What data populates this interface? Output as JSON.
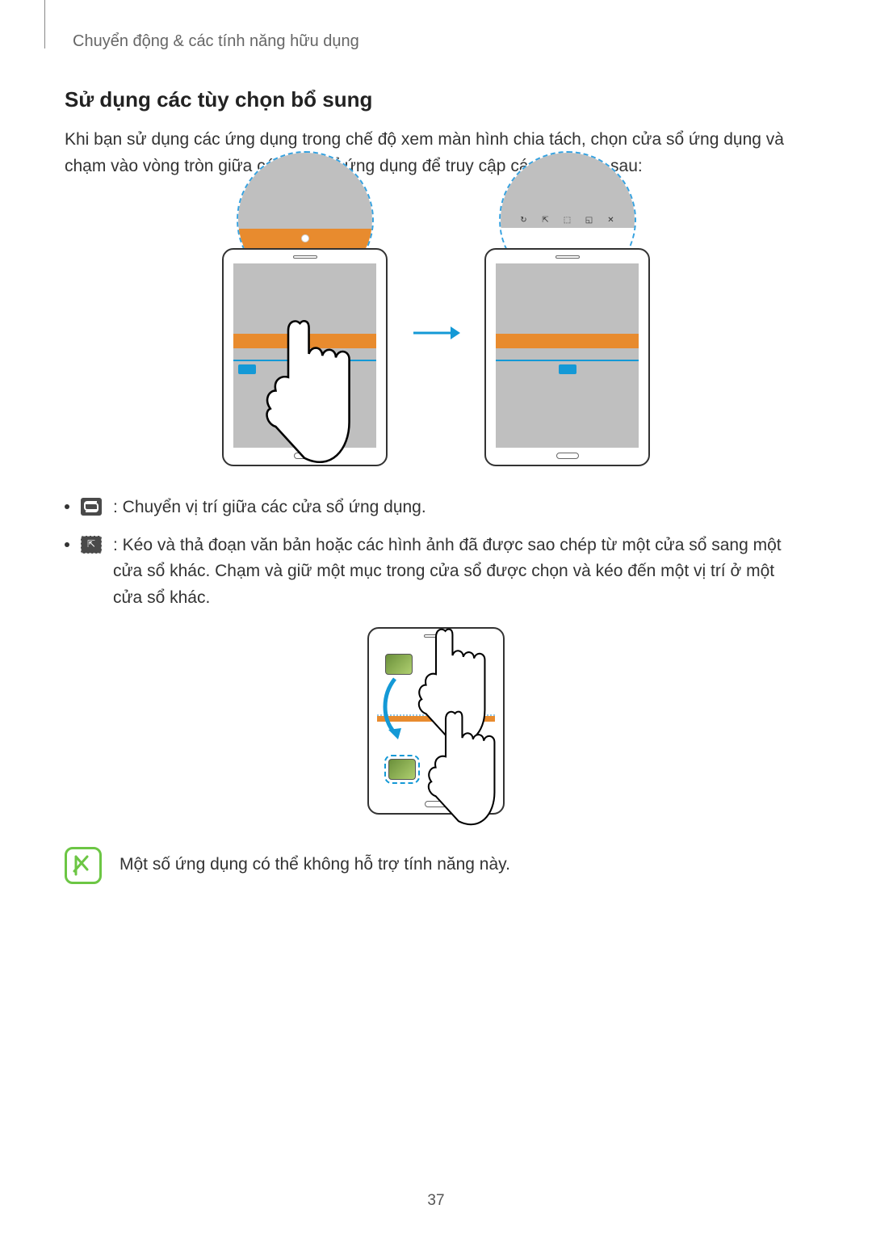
{
  "breadcrumb": "Chuyển động & các tính năng hữu dụng",
  "heading": "Sử dụng các tùy chọn bổ sung",
  "intro": "Khi bạn sử dụng các ứng dụng trong chế độ xem màn hình chia tách, chọn cửa sổ ứng dụng và chạm vào vòng tròn giữa các cửa sổ ứng dụng để truy cập các tùy chọn sau:",
  "bullets": {
    "swap": ": Chuyển vị trí giữa các cửa sổ ứng dụng.",
    "drag": ": Kéo và thả đoạn văn bản hoặc các hình ảnh đã được sao chép từ một cửa sổ sang một cửa sổ khác. Chạm và giữ một mục trong cửa sổ được chọn và kéo đến một vị trí ở một cửa sổ khác."
  },
  "note": "Một số ứng dụng có thể không hỗ trợ tính năng này.",
  "magnifier_icons": [
    "↻",
    "⇱",
    "⬚",
    "◱",
    "✕"
  ],
  "page_number": "37"
}
